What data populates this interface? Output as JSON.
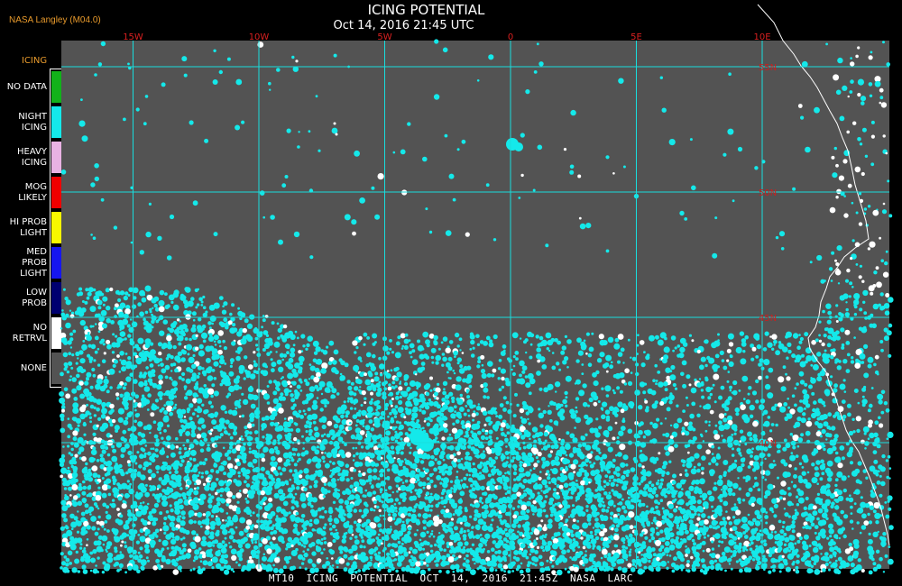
{
  "header": {
    "credit": "NASA Langley (M04.0)",
    "title": "ICING POTENTIAL",
    "subtitle": "Oct 14, 2016 21:45 UTC"
  },
  "legend": {
    "title": "ICING",
    "items": [
      {
        "label": "NO DATA",
        "color": "#12b21a"
      },
      {
        "label": "NIGHT\nICING",
        "color": "#14e9ea"
      },
      {
        "label": "HEAVY\nICING",
        "color": "#e9b2e3"
      },
      {
        "label": "MOG\nLIKELY",
        "color": "#f00000"
      },
      {
        "label": "HI PROB\nLIGHT",
        "color": "#f8f800"
      },
      {
        "label": "MED PROB\nLIGHT",
        "color": "#1616f0"
      },
      {
        "label": "LOW\nPROB",
        "color": "#000070"
      },
      {
        "label": "NO\nRETRVL",
        "color": "#ffffff"
      },
      {
        "label": "NONE",
        "color": "#535353"
      }
    ]
  },
  "map": {
    "background_color": "#535353",
    "grid_color": "#18dede",
    "icing_color": "#14e9ea",
    "no_retrieval_color": "#ffffff",
    "longitudes": [
      {
        "label": "15W",
        "value": -15
      },
      {
        "label": "10W",
        "value": -10
      },
      {
        "label": "5W",
        "value": -5
      },
      {
        "label": "0",
        "value": 0
      },
      {
        "label": "5E",
        "value": 5
      },
      {
        "label": "10E",
        "value": 10
      }
    ],
    "latitudes": [
      {
        "label": "55N",
        "value": 55
      },
      {
        "label": "50N",
        "value": 50
      },
      {
        "label": "45N",
        "value": 45
      },
      {
        "label": "40N",
        "value": 40
      }
    ],
    "lon_label_color": "#d82020",
    "lat_label_color": "#c82020"
  },
  "footer": {
    "text": "MT10  ICING POTENTIAL   OCT 14, 2016 21:45Z  NASA LARC"
  }
}
